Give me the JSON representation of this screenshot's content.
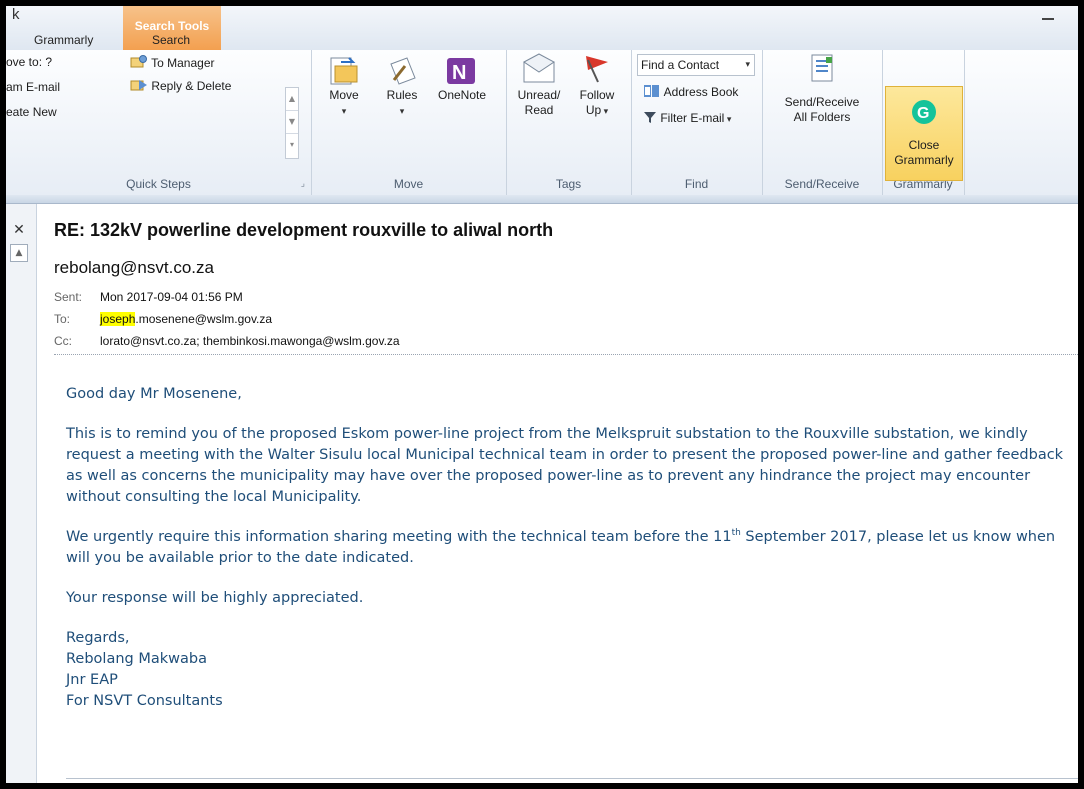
{
  "title_fragment": "k",
  "contextual_tab": "Search Tools",
  "tabs": [
    "Grammarly",
    "Search"
  ],
  "quick_steps": {
    "left_items": [
      "ove to: ?",
      "am E-mail",
      "eate New"
    ],
    "right_items": [
      "To Manager",
      "Reply & Delete"
    ],
    "label": "Quick Steps"
  },
  "move_group": {
    "move": "Move",
    "rules": "Rules",
    "onenote": "OneNote",
    "label": "Move"
  },
  "tags_group": {
    "unread_line1": "Unread/",
    "unread_line2": "Read",
    "follow_line1": "Follow",
    "follow_line2": "Up",
    "label": "Tags"
  },
  "find_group": {
    "find_contact": "Find a Contact",
    "address_book": "Address Book",
    "filter_email": "Filter E-mail",
    "label": "Find"
  },
  "sendreceive_group": {
    "line1": "Send/Receive",
    "line2": "All Folders",
    "label": "Send/Receive"
  },
  "grammarly_group": {
    "line1": "Close",
    "line2": "Grammarly",
    "label": "Grammarly"
  },
  "message": {
    "subject": "RE: 132kV powerline development rouxville to aliwal north",
    "from": "rebolang@nsvt.co.za",
    "sent_label": "Sent:",
    "sent_value": "Mon 2017-09-04 01:56 PM",
    "to_label": "To:",
    "to_highlight": "joseph",
    "to_rest": ".mosenene@wslm.gov.za",
    "cc_label": "Cc:",
    "cc_value": "lorato@nsvt.co.za; thembinkosi.mawonga@wslm.gov.za",
    "greeting": "Good day Mr Mosenene,",
    "para1": "This is to remind you of the proposed Eskom power-line project from the Melkspruit substation to the Rouxville substation, we kindly request a meeting with the Walter Sisulu local Municipal technical team in order to present the proposed power-line and gather feedback as well as concerns the municipality may have over the proposed power-line as to prevent any hindrance the project may encounter without consulting the local Municipality.",
    "para2_before": "We urgently require this information sharing meeting with the technical team before the 11",
    "para2_sup": "th",
    "para2_after": " September 2017, please let us know when will you be available prior to the date indicated.",
    "para3": "Your response will be highly appreciated.",
    "sig_regards": "Regards,",
    "sig_name": "Rebolang Makwaba",
    "sig_title": "Jnr EAP",
    "sig_company": "For NSVT Consultants"
  }
}
